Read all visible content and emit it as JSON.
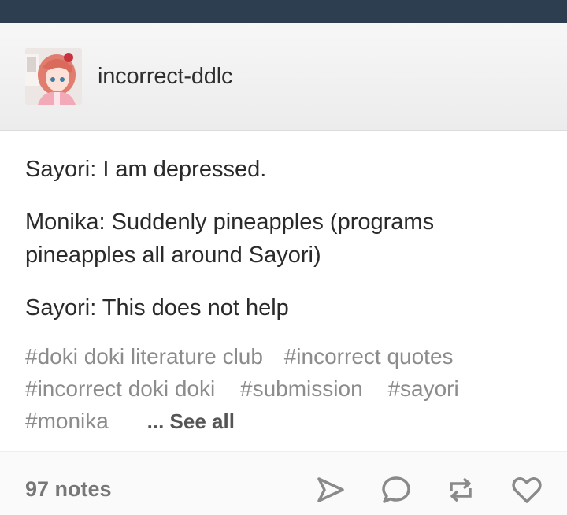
{
  "header": {
    "username": "incorrect-ddlc"
  },
  "post": {
    "lines": [
      "Sayori: I am depressed.",
      "Monika: Suddenly pineapples (programs pineapples all around Sayori)",
      "Sayori: This does not help"
    ]
  },
  "tags": {
    "items": [
      "#doki doki literature club",
      "#incorrect quotes",
      "#incorrect doki doki",
      "#submission",
      "#sayori",
      "#monika"
    ],
    "see_all": "... See all"
  },
  "footer": {
    "notes": "97 notes",
    "icons": [
      "share-icon",
      "reply-icon",
      "reblog-icon",
      "like-icon"
    ]
  },
  "colors": {
    "topbar": "#2c3e50",
    "text": "#2a2a2a",
    "tag": "#8c8c8c"
  }
}
